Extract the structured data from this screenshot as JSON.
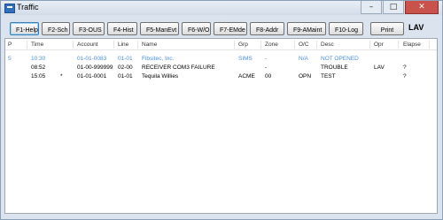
{
  "window": {
    "title": "Traffic",
    "controls": {
      "minimize": "–",
      "maximize": "□",
      "close": "✕"
    }
  },
  "toolbar": {
    "buttons": [
      "F1-Help",
      "F2-Sch",
      "F3-OUS",
      "F4-Hist",
      "F5-ManEvt",
      "F6-W/O",
      "F7-EMde",
      "F8-Addr",
      "F9-AMaint",
      "F10-Log",
      "Print"
    ],
    "status_label": "LAV"
  },
  "table": {
    "columns": {
      "p": "P",
      "time": "Time",
      "account": "Account",
      "line": "Line",
      "name": "Name",
      "grp": "Grp",
      "zone": "Zone",
      "oc": "O/C",
      "desc": "Desc",
      "opr": "Opr",
      "elapse": "Elapse"
    },
    "rows": [
      {
        "p": "5",
        "time": "10:30",
        "mark": "",
        "account": "01-01-0083",
        "line": "01-01",
        "name": "Fibsitec, Inc.",
        "grp": "SIMS",
        "zone": "-",
        "oc": "N/A",
        "desc": "NOT OPENED",
        "opr": "",
        "elapse": "",
        "color": "#4a90e2"
      },
      {
        "p": "",
        "time": "08:52",
        "mark": "",
        "account": "01-00-999999",
        "line": "02-00",
        "name": "RECEIVER COM3 FAILURE",
        "grp": "",
        "zone": "-",
        "oc": "",
        "desc": "TROUBLE",
        "opr": "LAV",
        "elapse": "?",
        "color": "#000000"
      },
      {
        "p": "",
        "time": "15:05",
        "mark": "*",
        "account": "01-01-0001",
        "line": "01-01",
        "name": "Tequila Willies",
        "grp": "ACME",
        "zone": "00",
        "oc": "OPN",
        "desc": "TEST",
        "opr": "",
        "elapse": "?",
        "color": "#000000"
      }
    ]
  }
}
